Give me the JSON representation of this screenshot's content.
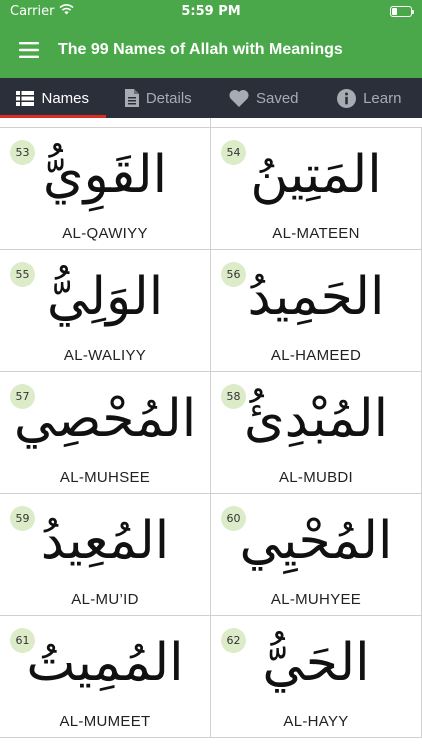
{
  "status": {
    "carrier": "Carrier",
    "time": "5:59 PM"
  },
  "header": {
    "title": "The 99 Names of Allah with Meanings"
  },
  "tabs": [
    {
      "label": "Names",
      "icon": "list-icon",
      "active": true
    },
    {
      "label": "Details",
      "icon": "document-icon",
      "active": false
    },
    {
      "label": "Saved",
      "icon": "heart-icon",
      "active": false
    },
    {
      "label": "Learn",
      "icon": "info-icon",
      "active": false
    }
  ],
  "names": [
    {
      "number": "53",
      "arabic": "القَوِيُّ",
      "translit": "AL-QAWIYY"
    },
    {
      "number": "54",
      "arabic": "المَتِينُ",
      "translit": "AL-MATEEN"
    },
    {
      "number": "55",
      "arabic": "الوَلِيُّ",
      "translit": "AL-WALIYY"
    },
    {
      "number": "56",
      "arabic": "الحَمِيدُ",
      "translit": "AL-HAMEED"
    },
    {
      "number": "57",
      "arabic": "المُحْصِي",
      "translit": "AL-MUHSEE"
    },
    {
      "number": "58",
      "arabic": "المُبْدِئُ",
      "translit": "AL-MUBDI"
    },
    {
      "number": "59",
      "arabic": "المُعِيدُ",
      "translit": "AL-MU’ID"
    },
    {
      "number": "60",
      "arabic": "المُحْيِي",
      "translit": "AL-MUHYEE"
    },
    {
      "number": "61",
      "arabic": "المُمِيتُ",
      "translit": "AL-MUMEET"
    },
    {
      "number": "62",
      "arabic": "الحَيُّ",
      "translit": "AL-HAYY"
    }
  ]
}
